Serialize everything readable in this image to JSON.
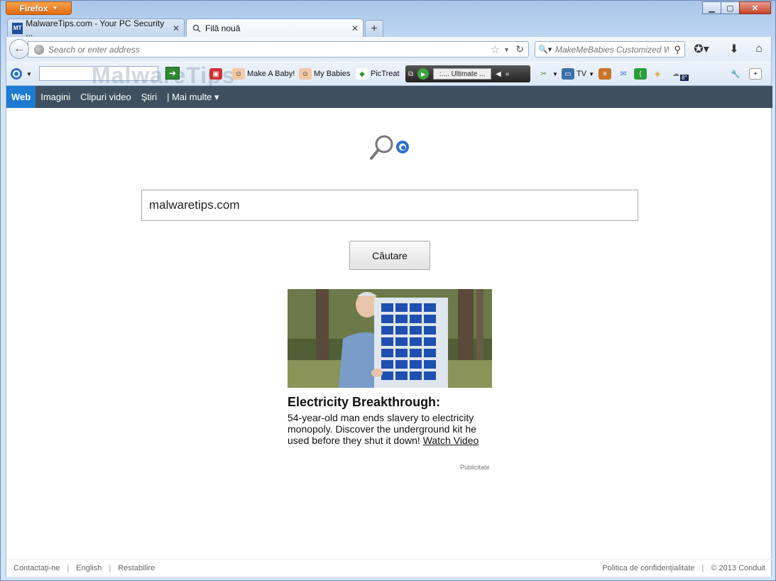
{
  "window": {
    "app_button": "Firefox",
    "controls": {
      "minimize": "▁",
      "maximize": "▢",
      "close": "✕"
    }
  },
  "tabs": [
    {
      "label": "MalwareTips.com - Your PC Security ...",
      "favicon": "MT",
      "active": false
    },
    {
      "label": "Filă nouă",
      "favicon": "search-icon",
      "active": true
    }
  ],
  "navbar": {
    "url_placeholder": "Search or enter address",
    "search_placeholder": "MakeMeBabies Customized W"
  },
  "toolbar": {
    "watermark": "MalwareTips",
    "links": [
      {
        "label": "Make A Baby!",
        "icon": "baby-icon"
      },
      {
        "label": "My Babies",
        "icon": "baby-icon"
      },
      {
        "label": "PicTreat",
        "icon": "pictreat-icon"
      }
    ],
    "player_station": ":.... Ultimate ...",
    "tv_label": "TV",
    "weather_badge": "8°"
  },
  "search_nav": {
    "items": [
      "Web",
      "Imagini",
      "Clipuri video",
      "Ştiri",
      "| Mai multe ▾"
    ]
  },
  "search": {
    "query": "malwaretips.com",
    "button_label": "Căutare"
  },
  "ad": {
    "title": "Electricity Breakthrough:",
    "body": "54-year-old man ends slavery to electricity monopoly. Discover the underground kit he used before they shut it down! ",
    "link": "Watch Video",
    "label": "Publicitate"
  },
  "footer": {
    "left": [
      "Contactaţi-ne",
      "English",
      "Restabilire"
    ],
    "privacy": "Politica de confidenţialitate",
    "copyright": "© 2013 Conduit"
  },
  "colors": {
    "search_nav_bg": "#3f4f5f",
    "search_nav_active": "#1f7bd1",
    "firefox_button": "#e56a10"
  }
}
